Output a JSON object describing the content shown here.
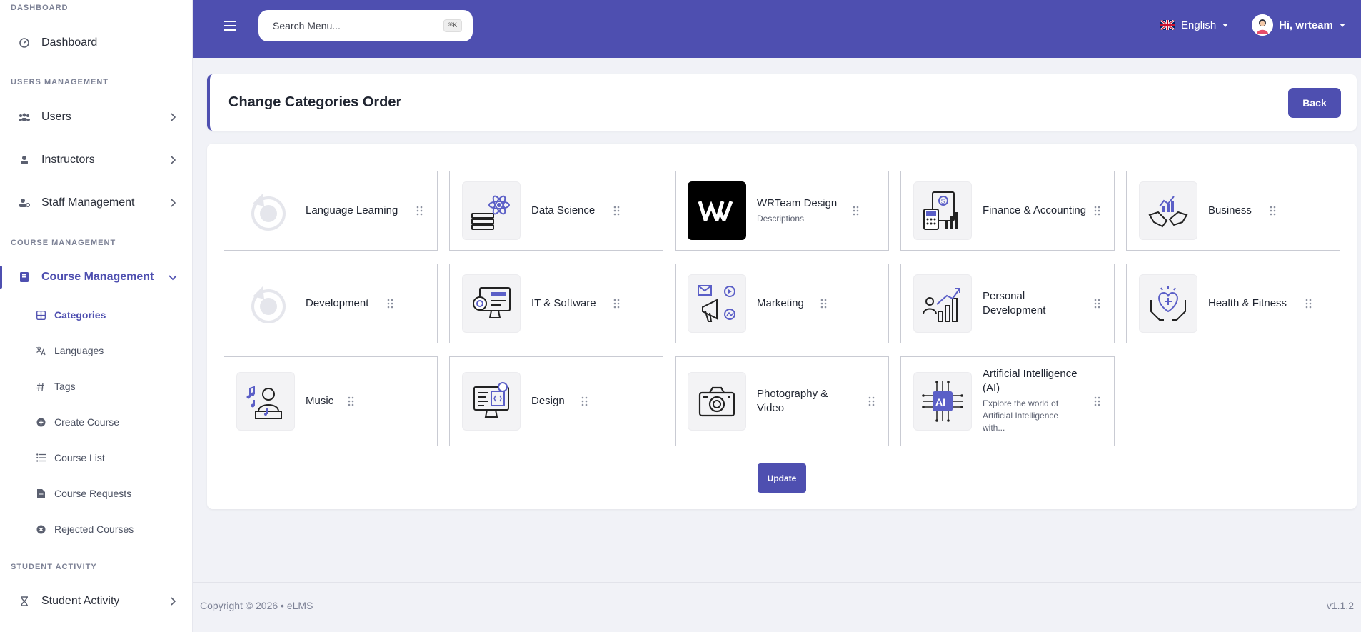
{
  "sidebar": {
    "sections": {
      "dashboard": "DASHBOARD",
      "users": "USERS MANAGEMENT",
      "course": "COURSE MANAGEMENT",
      "student": "STUDENT ACTIVITY"
    },
    "items": {
      "dashboard": "Dashboard",
      "users": "Users",
      "instructors": "Instructors",
      "staff": "Staff Management",
      "course_management": "Course Management",
      "student_activity": "Student Activity"
    },
    "sub_items": {
      "categories": "Categories",
      "languages": "Languages",
      "tags": "Tags",
      "create_course": "Create Course",
      "course_list": "Course List",
      "course_requests": "Course Requests",
      "rejected_courses": "Rejected Courses"
    }
  },
  "topbar": {
    "search_placeholder": "Search Menu...",
    "shortcut": "⌘K",
    "language": "English",
    "user": "Hi, wrteam"
  },
  "page": {
    "title": "Change Categories Order",
    "back_label": "Back",
    "update_label": "Update"
  },
  "categories": [
    {
      "name": "Language Learning",
      "desc": "",
      "icon": "placeholder-icon"
    },
    {
      "name": "Data Science",
      "desc": "",
      "icon": "data-science-icon"
    },
    {
      "name": "WRTeam Design",
      "desc": "Descriptions",
      "icon": "wrteam-logo"
    },
    {
      "name": "Finance & Accounting",
      "desc": "",
      "icon": "finance-icon"
    },
    {
      "name": "Business",
      "desc": "",
      "icon": "business-icon"
    },
    {
      "name": "Development",
      "desc": "",
      "icon": "placeholder-icon"
    },
    {
      "name": "IT & Software",
      "desc": "",
      "icon": "it-software-icon"
    },
    {
      "name": "Marketing",
      "desc": "",
      "icon": "marketing-icon"
    },
    {
      "name": "Personal Development",
      "desc": "",
      "icon": "personal-development-icon"
    },
    {
      "name": "Health & Fitness",
      "desc": "",
      "icon": "health-fitness-icon"
    },
    {
      "name": "Music",
      "desc": "",
      "icon": "music-icon"
    },
    {
      "name": "Design",
      "desc": "",
      "icon": "design-icon"
    },
    {
      "name": "Photography & Video",
      "desc": "",
      "icon": "camera-icon"
    },
    {
      "name": "Artificial Intelligence (AI)",
      "desc": "Explore the world of Artificial Intelligence with...",
      "icon": "ai-chip-icon"
    }
  ],
  "footer": {
    "copyright": "Copyright © 2026 • eLMS",
    "version": "v1.1.2"
  },
  "colors": {
    "accent": "#4e4fb0",
    "background": "#f1f2f7"
  }
}
